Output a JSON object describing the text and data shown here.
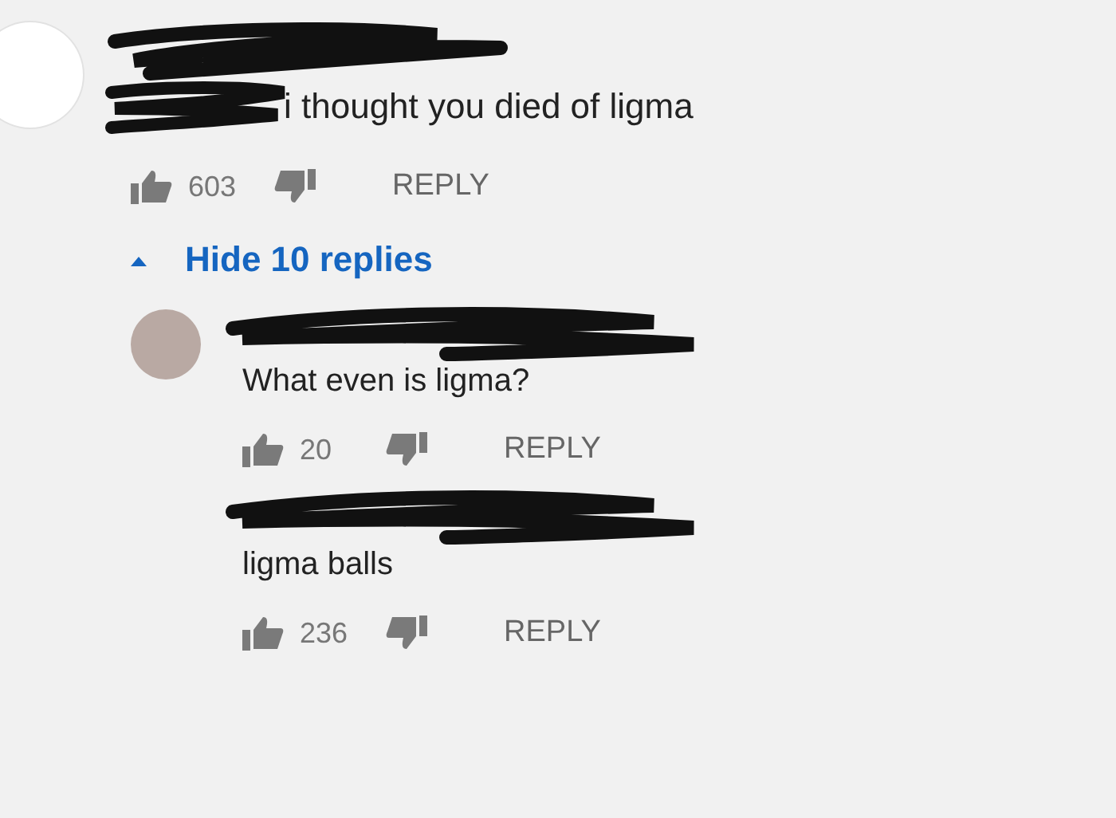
{
  "comment": {
    "body": "i thought you died of ligma",
    "likes": "603",
    "reply_label": "REPLY"
  },
  "replies_toggle": {
    "label": "Hide 10 replies",
    "expanded": true
  },
  "replies": [
    {
      "kind": "photo",
      "body": "What even is ligma?",
      "likes": "20",
      "reply_label": "REPLY"
    },
    {
      "kind": "plain",
      "body": "ligma balls",
      "likes": "236",
      "reply_label": "REPLY"
    }
  ]
}
